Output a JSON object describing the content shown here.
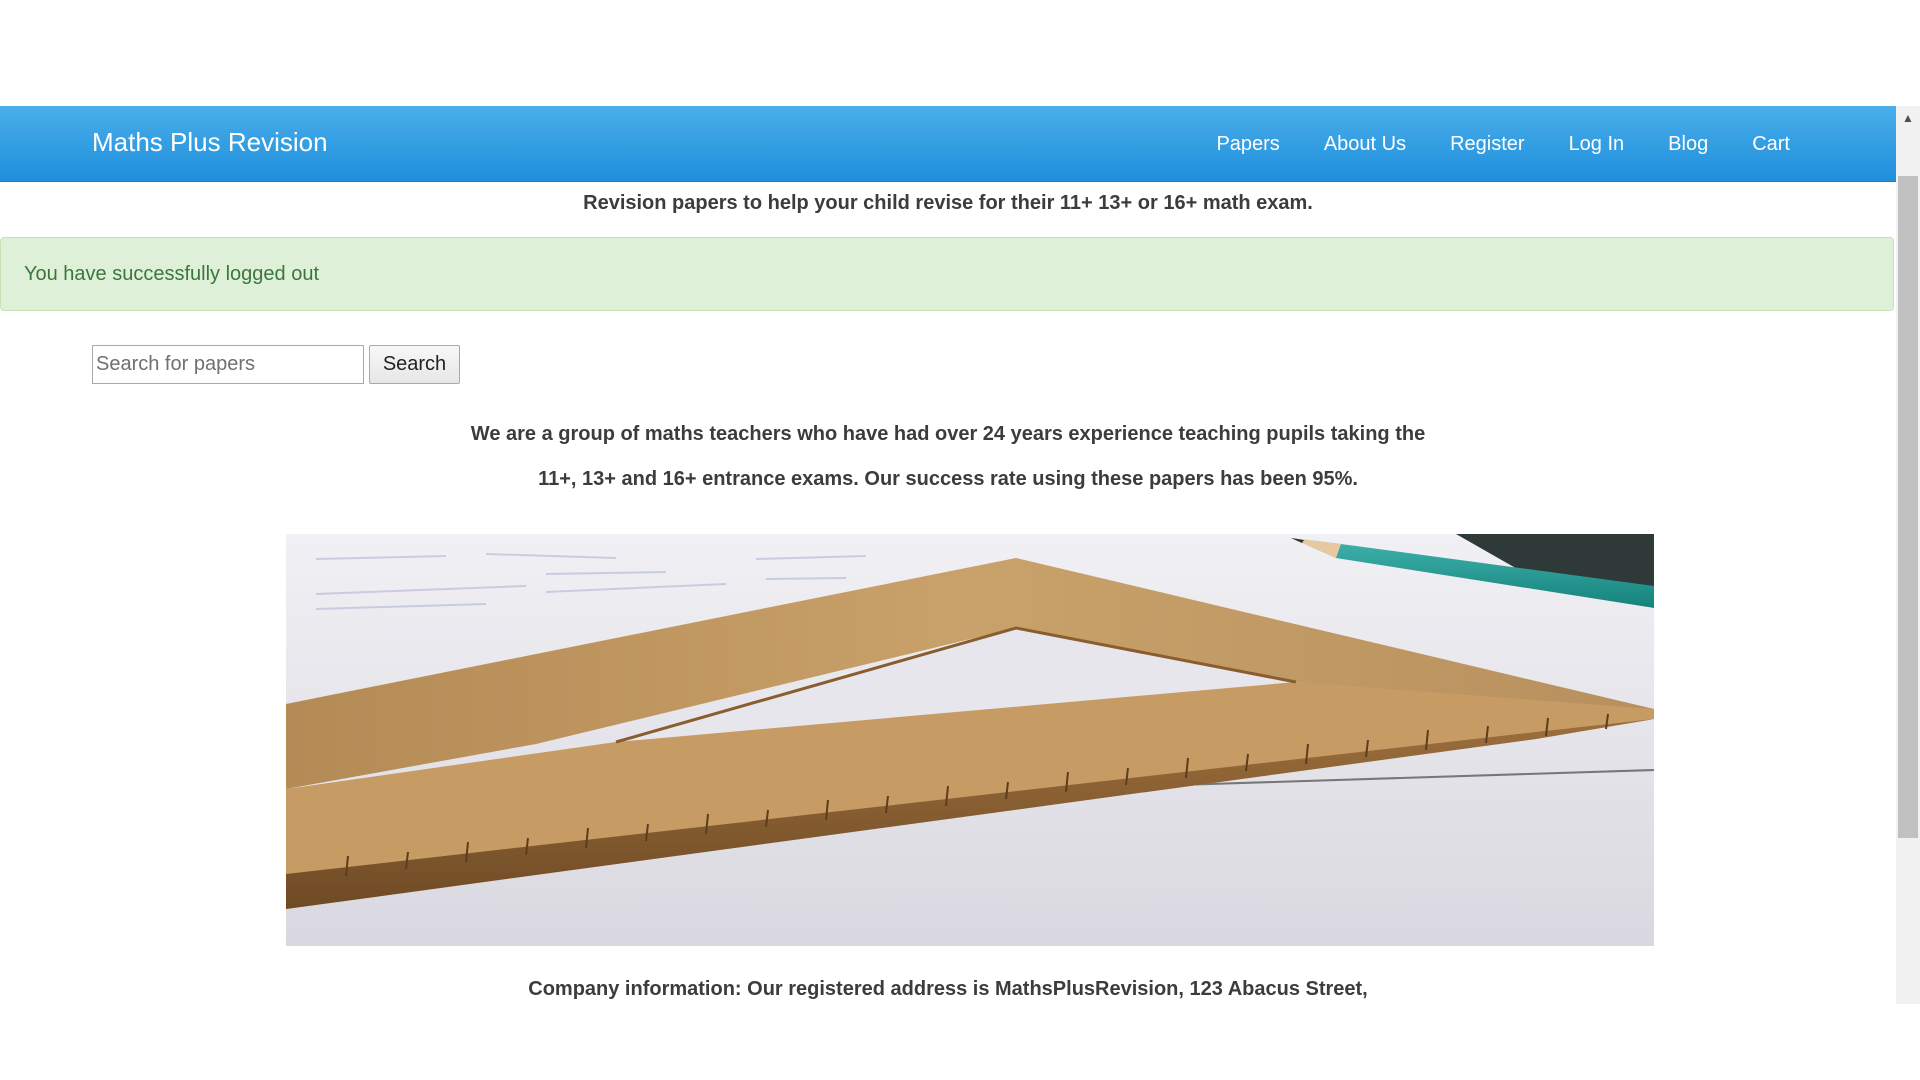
{
  "navbar": {
    "brand": "Maths Plus Revision",
    "links": [
      "Papers",
      "About Us",
      "Register",
      "Log In",
      "Blog",
      "Cart"
    ]
  },
  "tagline": "Revision papers to help your child revise for their 11+ 13+ or 16+ math exam.",
  "alert": {
    "message": "You have successfully logged out",
    "color": "#3c763d",
    "background": "#dff0d8"
  },
  "search": {
    "placeholder": "Search for papers",
    "value": "",
    "button_label": "Search"
  },
  "intro": {
    "line1": "We are a group of maths teachers who have had over 24 years experience teaching pupils taking the",
    "line2": "11+, 13+ and 16+ entrance exams. Our success rate using these papers has been 95%."
  },
  "hero_image": {
    "subject": "wooden set square ruler and pencil on paper"
  },
  "company_info": "Company information: Our registered address is MathsPlusRevision, 123 Abacus Street,",
  "colors": {
    "navbar": "#2b9be3",
    "text": "#3c3c3c"
  }
}
